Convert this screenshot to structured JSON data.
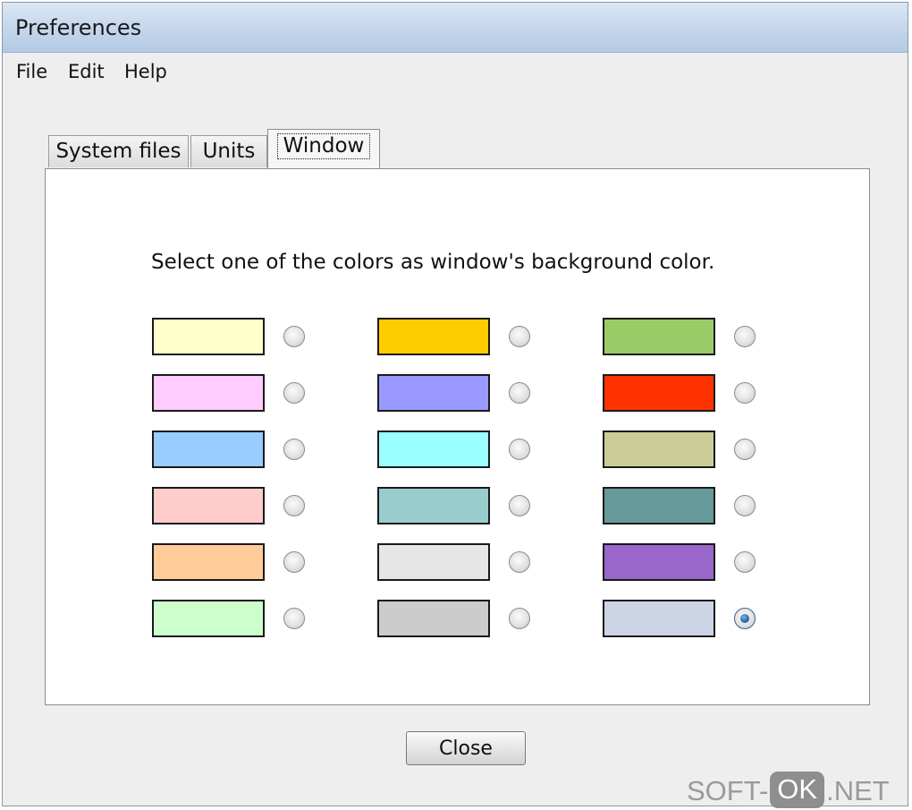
{
  "window": {
    "title": "Preferences"
  },
  "menu": {
    "items": [
      {
        "label": "File"
      },
      {
        "label": "Edit"
      },
      {
        "label": "Help"
      }
    ]
  },
  "tabs": [
    {
      "label": "System files",
      "active": false
    },
    {
      "label": "Units",
      "active": false
    },
    {
      "label": "Window",
      "active": true
    }
  ],
  "panel": {
    "instruction": "Select one of the colors as window's background color."
  },
  "colors": [
    {
      "hex": "#ffffcc",
      "selected": false
    },
    {
      "hex": "#ffccff",
      "selected": false
    },
    {
      "hex": "#99ccff",
      "selected": false
    },
    {
      "hex": "#ffcccc",
      "selected": false
    },
    {
      "hex": "#ffcc99",
      "selected": false
    },
    {
      "hex": "#ccffcc",
      "selected": false
    },
    {
      "hex": "#ffcc00",
      "selected": false
    },
    {
      "hex": "#9999ff",
      "selected": false
    },
    {
      "hex": "#99ffff",
      "selected": false
    },
    {
      "hex": "#99cccc",
      "selected": false
    },
    {
      "hex": "#e6e6e6",
      "selected": false
    },
    {
      "hex": "#cccccc",
      "selected": false
    },
    {
      "hex": "#99cc66",
      "selected": false
    },
    {
      "hex": "#ff3300",
      "selected": false
    },
    {
      "hex": "#cccc99",
      "selected": false
    },
    {
      "hex": "#669999",
      "selected": false
    },
    {
      "hex": "#9966cc",
      "selected": false
    },
    {
      "hex": "#ccd4e6",
      "selected": true
    }
  ],
  "buttons": {
    "close_label": "Close"
  },
  "watermark": {
    "pre": "SOFT-",
    "box": "OK",
    "post": ".NET"
  }
}
